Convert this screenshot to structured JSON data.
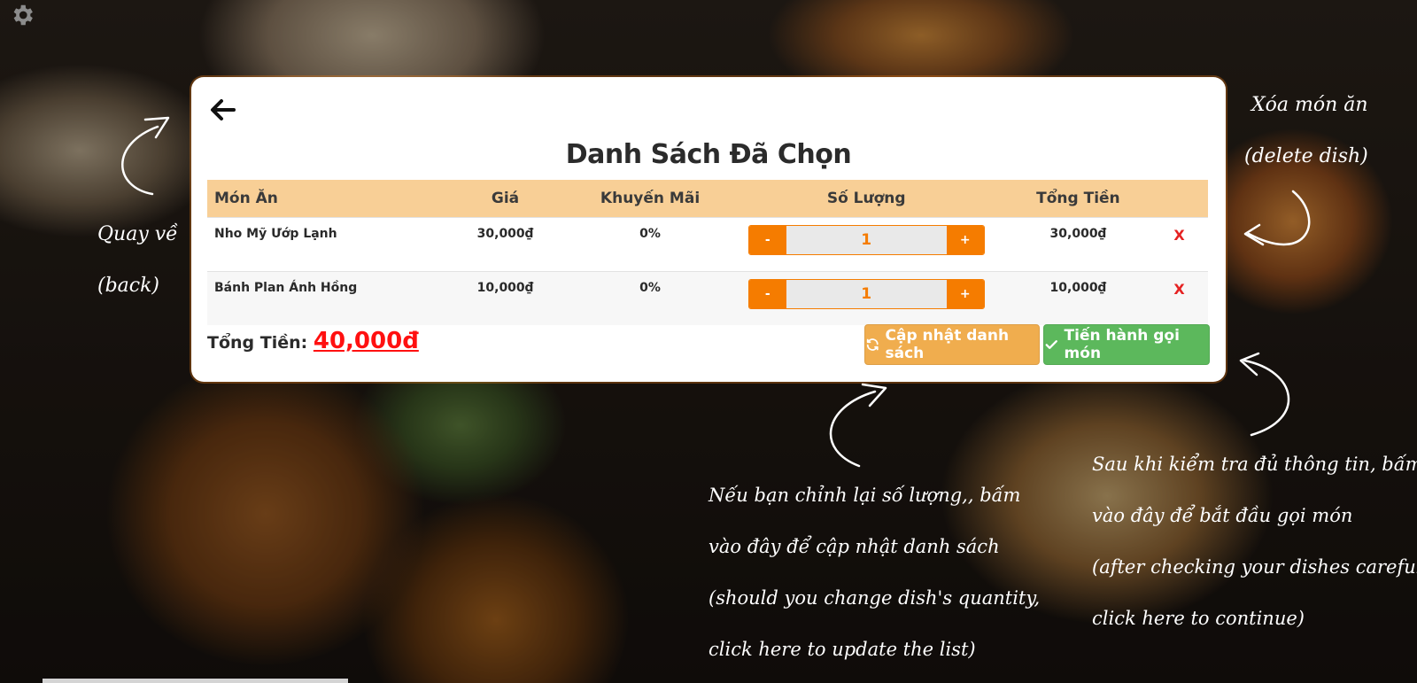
{
  "page": {
    "title": "Danh Sách Đã Chọn"
  },
  "table": {
    "headers": {
      "dish": "Món Ăn",
      "price": "Giá",
      "discount": "Khuyến Mãi",
      "quantity": "Số Lượng",
      "subtotal": "Tổng Tiền"
    },
    "rows": [
      {
        "dish": "Nho Mỹ Ướp Lạnh",
        "price": "30,000₫",
        "discount": "0%",
        "minus": "-",
        "quantity": "1",
        "plus": "+",
        "subtotal": "30,000₫",
        "delete": "X"
      },
      {
        "dish": "Bánh Plan Ánh Hồng",
        "price": "10,000₫",
        "discount": "0%",
        "minus": "-",
        "quantity": "1",
        "plus": "+",
        "subtotal": "10,000₫",
        "delete": "X"
      }
    ]
  },
  "footer": {
    "total_label": "Tổng Tiền:",
    "total_value": "40,000đ",
    "update_button": "Cập nhật danh sách",
    "order_button": "Tiến hành gọi món"
  },
  "annotations": {
    "back": [
      "Quay về",
      "(back)"
    ],
    "delete": [
      "Xóa món ăn",
      "(delete dish)"
    ],
    "update": [
      "Nếu bạn chỉnh lại số lượng,, bấm",
      "vào đây để cập nhật danh sách",
      "(should you change dish's quantity,",
      "click here to update the list)"
    ],
    "order": [
      "Sau khi kiểm tra đủ thông tin, bấm",
      "vào đây để bắt đầu gọi món",
      "(after checking your dishes carefully",
      "click here to continue)"
    ]
  },
  "colors": {
    "header_bg": "#f8cf96",
    "accent_orange": "#f57c00",
    "update_btn": "#f0ad4e",
    "order_btn": "#5cb85c",
    "total_red": "#ff1010",
    "delete_red": "#e52222"
  },
  "icons": {
    "settings": "gear-icon",
    "back": "arrow-left-icon",
    "update": "refresh-icon",
    "order": "check-icon"
  }
}
